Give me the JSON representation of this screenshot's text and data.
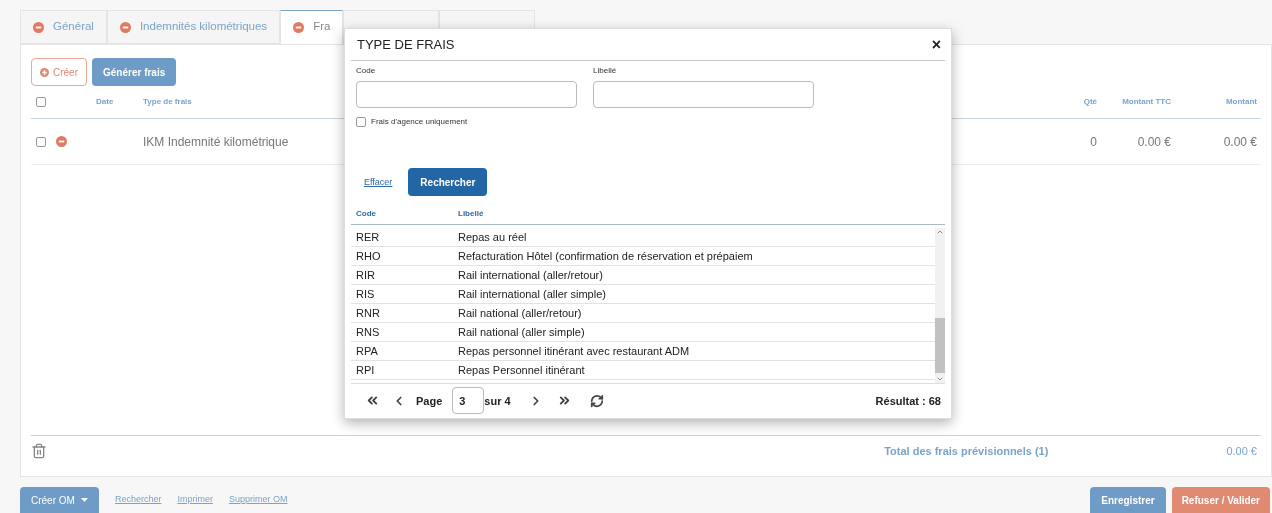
{
  "tabs": [
    {
      "label": "Général",
      "selected": false
    },
    {
      "label": "Indemnités kilométriques",
      "selected": false
    },
    {
      "label": "Fra",
      "selected": true
    },
    {
      "selected": false
    },
    {
      "selected": false
    }
  ],
  "toolbar": {
    "create": "Créer",
    "generate": "Générer frais"
  },
  "table": {
    "select_all_checked": false,
    "columns": [
      "Date",
      "Type de frais",
      "Qté",
      "Montant TTC",
      "Montant"
    ],
    "rows": [
      {
        "checked": false,
        "date": "",
        "type": "IKM Indemnité kilométrique",
        "qty": "0",
        "amount_ttc": "0.00 €",
        "amount": "0.00 €"
      }
    ]
  },
  "total": {
    "label": "Total des frais prévisionnels (1)",
    "value": "0.00 €"
  },
  "footer": {
    "create_om": "Créer OM",
    "links": [
      "Rechercher",
      "Imprimer",
      "Supprimer OM"
    ],
    "save": "Enregistrer",
    "validate": "Refuser / Valider"
  },
  "dialog": {
    "title": "TYPE DE FRAIS",
    "close": "×",
    "fields": [
      {
        "label": "Code"
      },
      {
        "label": "Libellé"
      }
    ],
    "agency_only": {
      "label": "Frais d'agence uniquement",
      "checked": false
    },
    "clear": "Effacer",
    "search": "Rechercher",
    "columns": [
      "Code",
      "Libellé"
    ],
    "rows": [
      {
        "code": "RER",
        "label": "Repas au réel"
      },
      {
        "code": "RHO",
        "label": "Refacturation Hôtel (confirmation de réservation et prépaiem"
      },
      {
        "code": "RIR",
        "label": "Rail international (aller/retour)"
      },
      {
        "code": "RIS",
        "label": "Rail international (aller simple)"
      },
      {
        "code": "RNR",
        "label": "Rail national (aller/retour)"
      },
      {
        "code": "RNS",
        "label": "Rail national (aller simple)"
      },
      {
        "code": "RPA",
        "label": "Repas personnel itinérant avec restaurant ADM"
      },
      {
        "code": "RPI",
        "label": "Repas Personnel itinérant"
      }
    ],
    "pager": {
      "page_label": "Page",
      "page": "3",
      "of": "sur 4",
      "result": "Résultat : 68"
    }
  }
}
